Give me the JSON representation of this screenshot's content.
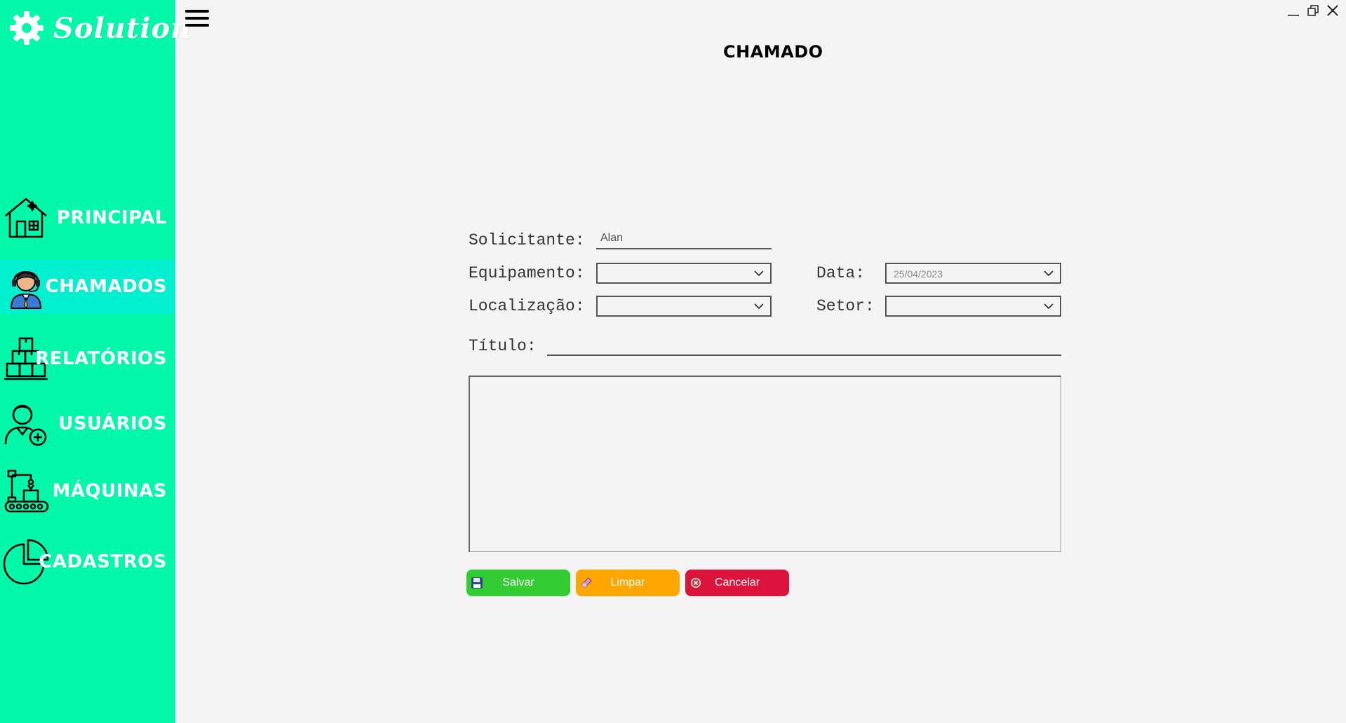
{
  "app": {
    "logo_text": "Solution"
  },
  "colors": {
    "sidebar": "#00f8a8",
    "sidebar_active": "#00f0d0",
    "save": "#33cc33",
    "clear": "#ffa500",
    "cancel": "#dc143c"
  },
  "sidebar": {
    "items": [
      {
        "label": "PRINCIPAL",
        "icon": "house-icon"
      },
      {
        "label": "CHAMADOS",
        "icon": "support-agent-icon",
        "active": true
      },
      {
        "label": "RELATÓRIOS",
        "icon": "boxes-icon"
      },
      {
        "label": "USUÁRIOS",
        "icon": "user-add-icon"
      },
      {
        "label": "MÁQUINAS",
        "icon": "robot-arm-conveyor-icon"
      },
      {
        "label": "CADASTROS",
        "icon": "pie-chart-icon"
      }
    ]
  },
  "header": {
    "title": "CHAMADO"
  },
  "form": {
    "solicitante": {
      "label": "Solicitante:",
      "value": "Alan"
    },
    "equipamento": {
      "label": "Equipamento:",
      "value": ""
    },
    "data": {
      "label": "Data:",
      "value": "25/04/2023"
    },
    "localizacao": {
      "label": "Localização:",
      "value": ""
    },
    "setor": {
      "label": "Setor:",
      "value": ""
    },
    "titulo": {
      "label": "Título:",
      "value": ""
    },
    "descricao": {
      "value": ""
    }
  },
  "buttons": {
    "save": {
      "label": "Salvar",
      "icon": "floppy-disk-icon"
    },
    "clear": {
      "label": "Limpar",
      "icon": "eraser-icon"
    },
    "cancel": {
      "label": "Cancelar",
      "icon": "cancel-x-icon"
    }
  }
}
